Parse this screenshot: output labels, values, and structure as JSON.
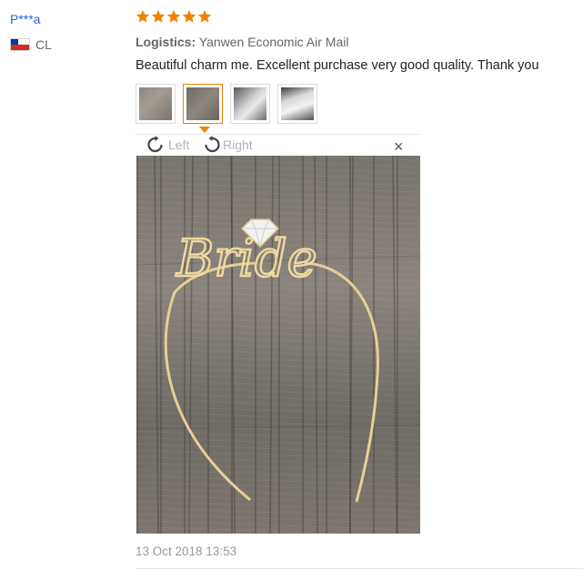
{
  "user": {
    "name": "P***a",
    "country_code": "CL",
    "flag_icon": "chile-flag-icon"
  },
  "review": {
    "rating": 5,
    "max_rating": 5,
    "star_color": "#f08200",
    "logistics_label": "Logistics:",
    "logistics_value": "Yanwen Economic Air Mail",
    "feedback": "Beautiful charm me. Excellent purchase very good quality. Thank you",
    "thumbnails": [
      "thumbnail-1",
      "thumbnail-2",
      "thumbnail-3",
      "thumbnail-4"
    ],
    "active_thumbnail": 2,
    "date": "13 Oct 2018 13:53"
  },
  "viewer": {
    "rotate_left_label": "Left",
    "rotate_right_label": "Right",
    "close_label": "×",
    "photo_text": "Bride"
  },
  "colors": {
    "accent": "#f08200",
    "link": "#2468c7",
    "muted": "#999999"
  }
}
